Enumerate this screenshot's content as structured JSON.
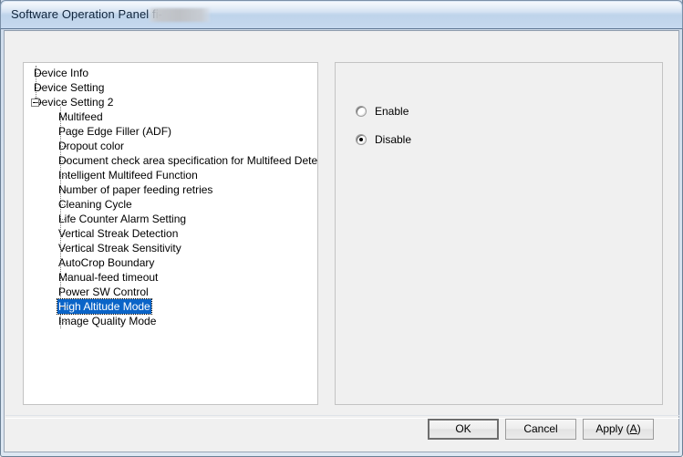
{
  "window": {
    "title_prefix": "Software Operation Panel fi-",
    "title_redacted": ""
  },
  "tree": {
    "items": [
      {
        "label": "Device Info",
        "level": 0,
        "expander": false,
        "selected": false
      },
      {
        "label": "Device Setting",
        "level": 0,
        "expander": false,
        "selected": false
      },
      {
        "label": "Device Setting 2",
        "level": 0,
        "expander": true,
        "selected": false
      },
      {
        "label": "Multifeed",
        "level": 1,
        "expander": false,
        "selected": false
      },
      {
        "label": "Page Edge Filler (ADF)",
        "level": 1,
        "expander": false,
        "selected": false
      },
      {
        "label": "Dropout color",
        "level": 1,
        "expander": false,
        "selected": false
      },
      {
        "label": "Document check area specification for Multifeed Detection",
        "level": 1,
        "expander": false,
        "selected": false
      },
      {
        "label": "Intelligent Multifeed Function",
        "level": 1,
        "expander": false,
        "selected": false
      },
      {
        "label": "Number of paper feeding retries",
        "level": 1,
        "expander": false,
        "selected": false
      },
      {
        "label": "Cleaning Cycle",
        "level": 1,
        "expander": false,
        "selected": false
      },
      {
        "label": "Life Counter Alarm Setting",
        "level": 1,
        "expander": false,
        "selected": false
      },
      {
        "label": "Vertical Streak Detection",
        "level": 1,
        "expander": false,
        "selected": false
      },
      {
        "label": "Vertical Streak Sensitivity",
        "level": 1,
        "expander": false,
        "selected": false
      },
      {
        "label": "AutoCrop Boundary",
        "level": 1,
        "expander": false,
        "selected": false
      },
      {
        "label": "Manual-feed timeout",
        "level": 1,
        "expander": false,
        "selected": false
      },
      {
        "label": "Power SW Control",
        "level": 1,
        "expander": false,
        "selected": false
      },
      {
        "label": "High Altitude Mode",
        "level": 1,
        "expander": false,
        "selected": true
      },
      {
        "label": "Image Quality Mode",
        "level": 1,
        "expander": false,
        "selected": false
      }
    ]
  },
  "settings": {
    "options": [
      {
        "label": "Enable",
        "checked": false
      },
      {
        "label": "Disable",
        "checked": true
      }
    ]
  },
  "buttons": {
    "ok": "OK",
    "cancel": "Cancel",
    "apply_text": "Apply (",
    "apply_accel": "A",
    "apply_close": ")"
  },
  "colors": {
    "selection": "#0a64c8",
    "selection_text": "#ffffff",
    "dialog_bg": "#f0f0f0",
    "panel_bg": "#ffffff",
    "titlebar": "#c9daef"
  }
}
